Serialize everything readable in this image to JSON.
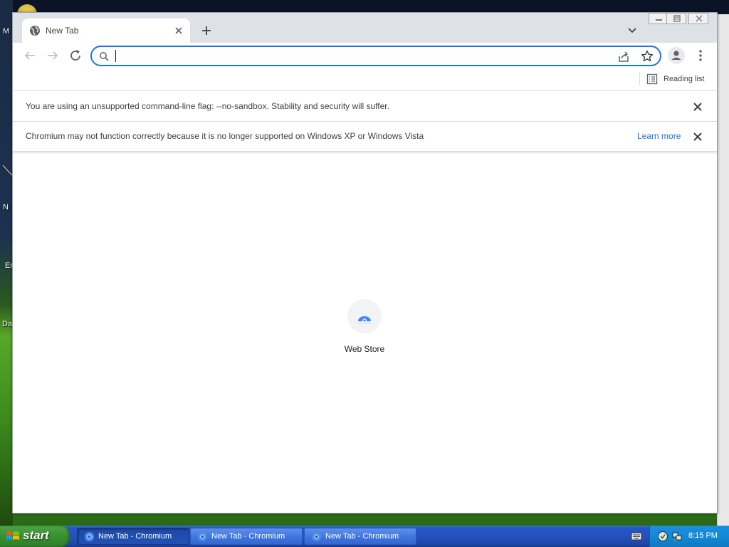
{
  "desktop": {
    "labels": [
      "M",
      "N",
      "Er",
      "Da"
    ]
  },
  "browser": {
    "tab": {
      "title": "New Tab",
      "favicon": "globe-icon"
    },
    "omnibox": {
      "value": "",
      "placeholder": ""
    },
    "bookmarks": {
      "reading_list_label": "Reading list"
    },
    "infobars": [
      {
        "text": "You are using an unsupported command-line flag: --no-sandbox. Stability and security will suffer."
      },
      {
        "text": "Chromium may not function correctly because it is no longer supported on Windows XP or Windows Vista",
        "link": "Learn more"
      }
    ],
    "shortcut": {
      "label": "Web Store"
    },
    "colors": {
      "accent": "#1a73e8",
      "tabstrip": "#dee1e6"
    }
  },
  "taskbar": {
    "start_label": "start",
    "tasks": [
      {
        "label": "New Tab - Chromium",
        "active": true
      },
      {
        "label": "New Tab - Chromium",
        "active": false
      },
      {
        "label": "New Tab - Chromium",
        "active": false
      }
    ],
    "clock": "8:15 PM"
  }
}
